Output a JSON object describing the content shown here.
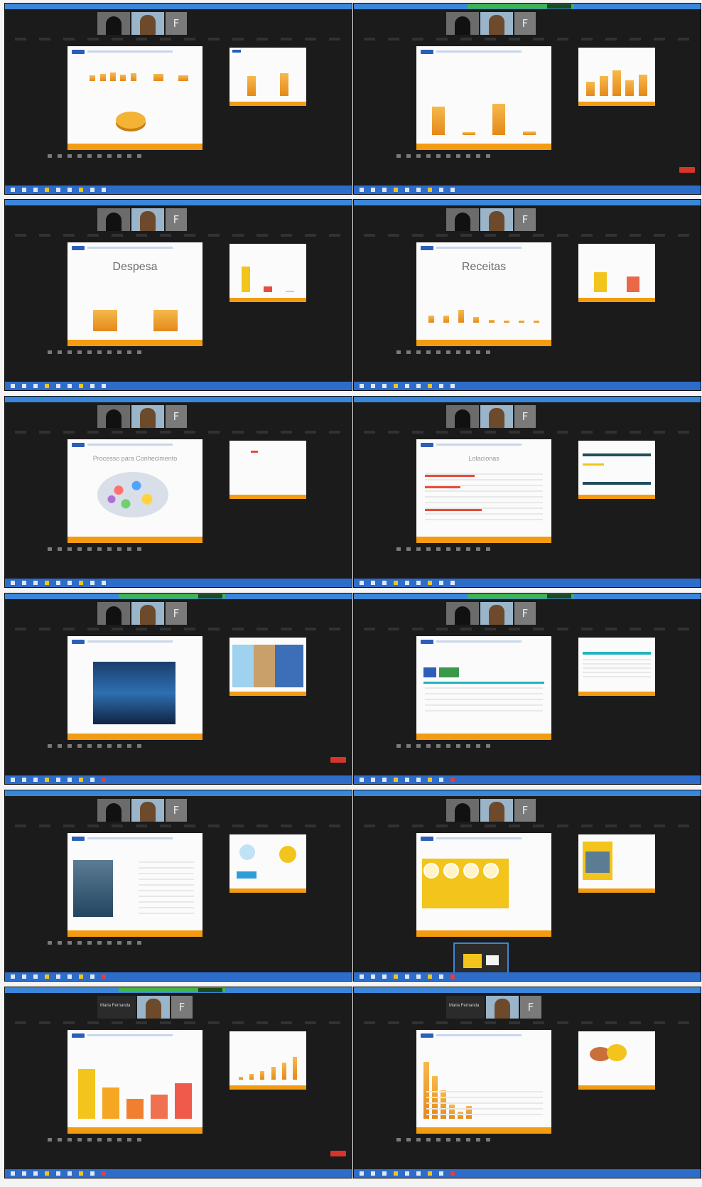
{
  "accent": "#f39c12",
  "panel_bg": "#1b1b1b",
  "taskbar_color": "#2d6cc9",
  "panels": [
    {
      "id": 1,
      "slide_kind": "bar-pie",
      "rec": false,
      "names": [
        "",
        "",
        ""
      ]
    },
    {
      "id": 2,
      "slide_kind": "bars",
      "rec": true,
      "names": [
        "",
        "",
        ""
      ]
    },
    {
      "id": 3,
      "slide_kind": "bars",
      "title": "Despesa",
      "rec": false
    },
    {
      "id": 4,
      "slide_kind": "bars",
      "title": "Receitas",
      "rec": false
    },
    {
      "id": 5,
      "slide_kind": "cloud",
      "title": "Processo para Conhecimento",
      "rec": false
    },
    {
      "id": 6,
      "slide_kind": "text",
      "title": "Lotacionas",
      "rec": false
    },
    {
      "id": 7,
      "slide_kind": "screen",
      "rec": true
    },
    {
      "id": 8,
      "slide_kind": "text",
      "rec": true
    },
    {
      "id": 9,
      "slide_kind": "doc",
      "rec": false
    },
    {
      "id": 10,
      "slide_kind": "yellow",
      "rec": false
    },
    {
      "id": 11,
      "slide_kind": "bars",
      "rec": true,
      "names": [
        "Maria Fernanda",
        "",
        ""
      ]
    },
    {
      "id": 12,
      "slide_kind": "bars",
      "rec": false,
      "names": [
        "Maria Fernanda",
        "",
        ""
      ]
    }
  ],
  "common": {
    "letter_tile": "F",
    "icons": [
      "mic-icon",
      "video-icon",
      "share-icon",
      "participants-icon",
      "chat-icon",
      "record-icon",
      "end-icon"
    ]
  }
}
